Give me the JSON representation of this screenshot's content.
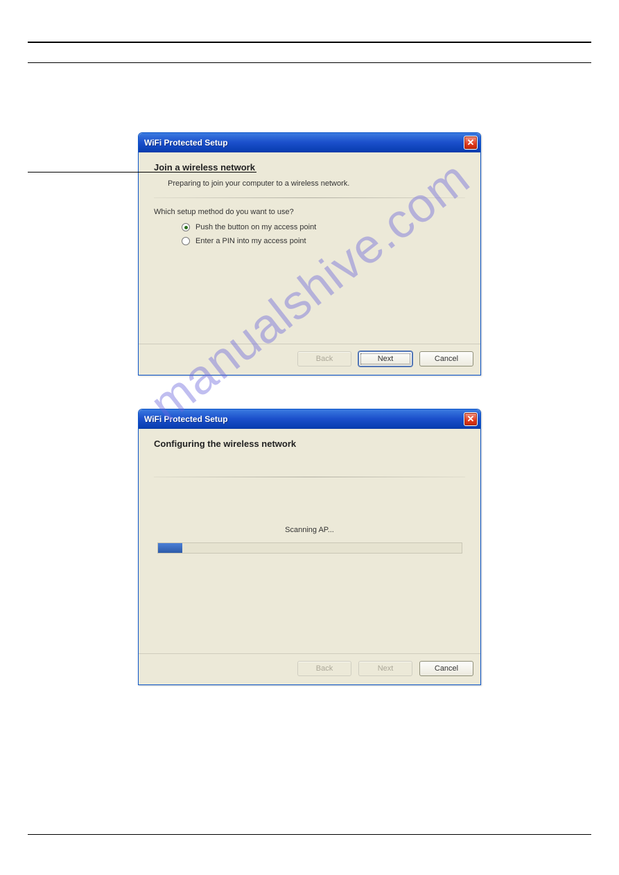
{
  "watermark": "manualshive.com",
  "dialog1": {
    "title": "WiFi Protected Setup",
    "heading": "Join a wireless network",
    "subheading": "Preparing to join your computer to a wireless network.",
    "question": "Which setup method do you want to use?",
    "option_push": "Push the button on my access point",
    "option_pin": "Enter a PIN into my access point",
    "back": "Back",
    "next": "Next",
    "cancel": "Cancel"
  },
  "dialog2": {
    "title": "WiFi Protected Setup",
    "heading": "Configuring the wireless network",
    "status": "Scanning AP...",
    "back": "Back",
    "next": "Next",
    "cancel": "Cancel"
  }
}
